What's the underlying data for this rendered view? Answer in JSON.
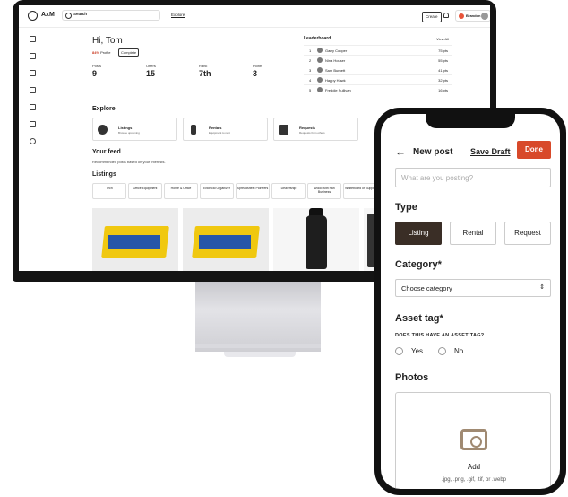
{
  "desktop": {
    "brand": "AxM",
    "search_placeholder": "Search",
    "nav_explore": "Explore",
    "create_label": "Create",
    "user_name": "Brandon",
    "greeting": "Hi, Tom",
    "profile_prefix": "84%",
    "profile_label": "Profile",
    "complete_label": "Complete",
    "stats": [
      {
        "label": "Posts",
        "value": "9"
      },
      {
        "label": "Offers",
        "value": "15"
      },
      {
        "label": "Rank",
        "value": "7th"
      },
      {
        "label": "Points",
        "value": "3"
      }
    ],
    "leaderboard": {
      "title": "Leaderboard",
      "view_all": "View All",
      "rows": [
        {
          "rank": "1",
          "name": "Garry Cooper",
          "score": "75 pts"
        },
        {
          "rank": "2",
          "name": "Nina Houser",
          "score": "55 pts"
        },
        {
          "rank": "3",
          "name": "Sam Burnett",
          "score": "41 pts"
        },
        {
          "rank": "4",
          "name": "Happy Hawk",
          "score": "32 pts"
        },
        {
          "rank": "5",
          "name": "Freddie Sullivan",
          "score": "16 pts"
        }
      ]
    },
    "explore": {
      "title": "Explore",
      "cards": [
        {
          "title": "Listings",
          "desc": "Browse upcoming"
        },
        {
          "title": "Rentals",
          "desc": "Equipment to rent"
        },
        {
          "title": "Requests",
          "desc": "Requests from others"
        }
      ]
    },
    "feed": {
      "title": "Your feed",
      "subtitle": "Recommended posts based on your interests."
    },
    "listings": {
      "title": "Listings",
      "chips": [
        "Tech",
        "Office Equipment",
        "Home & Office",
        "Ebonical Organizer",
        "Spreadsheet Pioneers",
        "Dealership",
        "Wood with Fan Business",
        "Whiteboard or Supply"
      ]
    },
    "rail_icons": [
      "home-icon",
      "chat-icon",
      "clipboard-icon",
      "building-icon",
      "chart-icon",
      "inbox-icon",
      "help-icon"
    ]
  },
  "phone": {
    "title": "New post",
    "save_draft": "Save Draft",
    "done": "Done",
    "input_placeholder": "What are you posting?",
    "type_heading": "Type",
    "types": [
      "Listing",
      "Rental",
      "Request"
    ],
    "selected_type": "Listing",
    "category_heading": "Category*",
    "category_placeholder": "Choose category",
    "asset_heading": "Asset tag*",
    "asset_question": "DOES THIS HAVE AN ASSET TAG?",
    "asset_yes": "Yes",
    "asset_no": "No",
    "photos_heading": "Photos",
    "add_label": "Add",
    "formats": ".jpg, .png, .gif, .tif, or .webp"
  },
  "colors": {
    "accent": "#d8492a",
    "selected_type_bg": "#3a2e26"
  }
}
